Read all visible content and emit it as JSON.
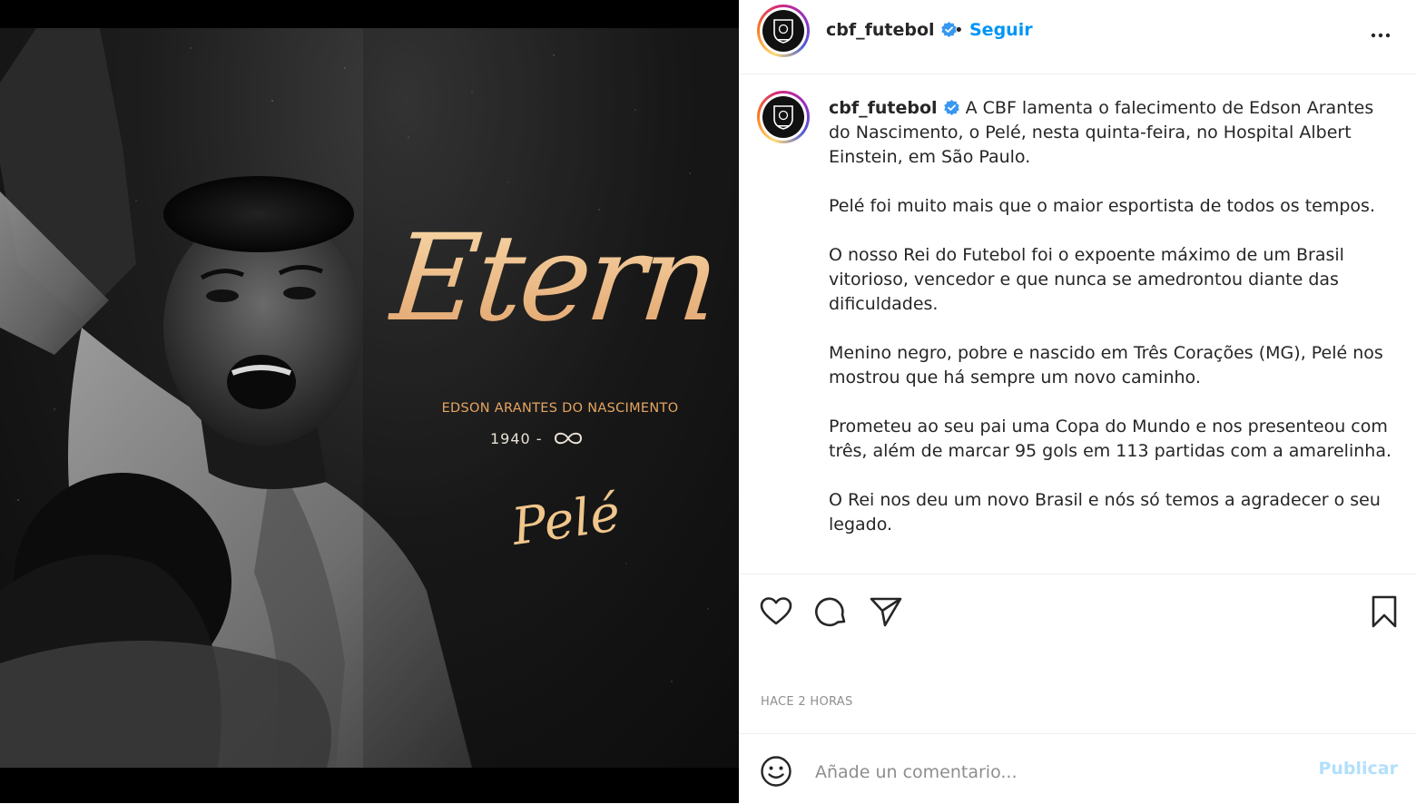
{
  "post": {
    "image": {
      "title": "Eterno",
      "name": "EDSON ARANTES DO NASCIMENTO",
      "years": "1940 -",
      "signature": "Pelé"
    }
  },
  "header": {
    "username": "cbf_futebol",
    "separator": "•",
    "follow_label": "Seguir"
  },
  "caption": {
    "username": "cbf_futebol",
    "paragraphs": [
      "A CBF lamenta o falecimento de Edson Arantes do Nascimento, o Pelé, nesta quinta-feira, no Hospital Albert Einstein, em São Paulo.",
      "Pelé foi muito mais que o maior esportista de todos os tempos.",
      "O nosso Rei do Futebol foi o expoente máximo de um Brasil vitorioso, vencedor e que nunca se amedrontou diante das dificuldades.",
      "Menino negro, pobre e nascido em Três Corações (MG), Pelé nos mostrou que há sempre um novo caminho.",
      "Prometeu ao seu pai uma Copa do Mundo e nos presenteou com três, além de marcar 95 gols em 113 partidas com a amarelinha.",
      "O Rei nos deu um novo Brasil e nós só temos a agradecer o seu legado."
    ]
  },
  "actions": {
    "timestamp": "HACE 2 HORAS"
  },
  "comment": {
    "placeholder": "Añade un comentario...",
    "publish_label": "Publicar"
  },
  "colors": {
    "accent": "#0095f6",
    "publish_disabled": "#b2dffc",
    "gold": "#e6a561",
    "verified": "#3897f0"
  },
  "icons": [
    "verified-icon",
    "more-icon",
    "heart-icon",
    "comment-icon",
    "share-icon",
    "bookmark-icon",
    "emoji-icon",
    "infinity-icon"
  ]
}
